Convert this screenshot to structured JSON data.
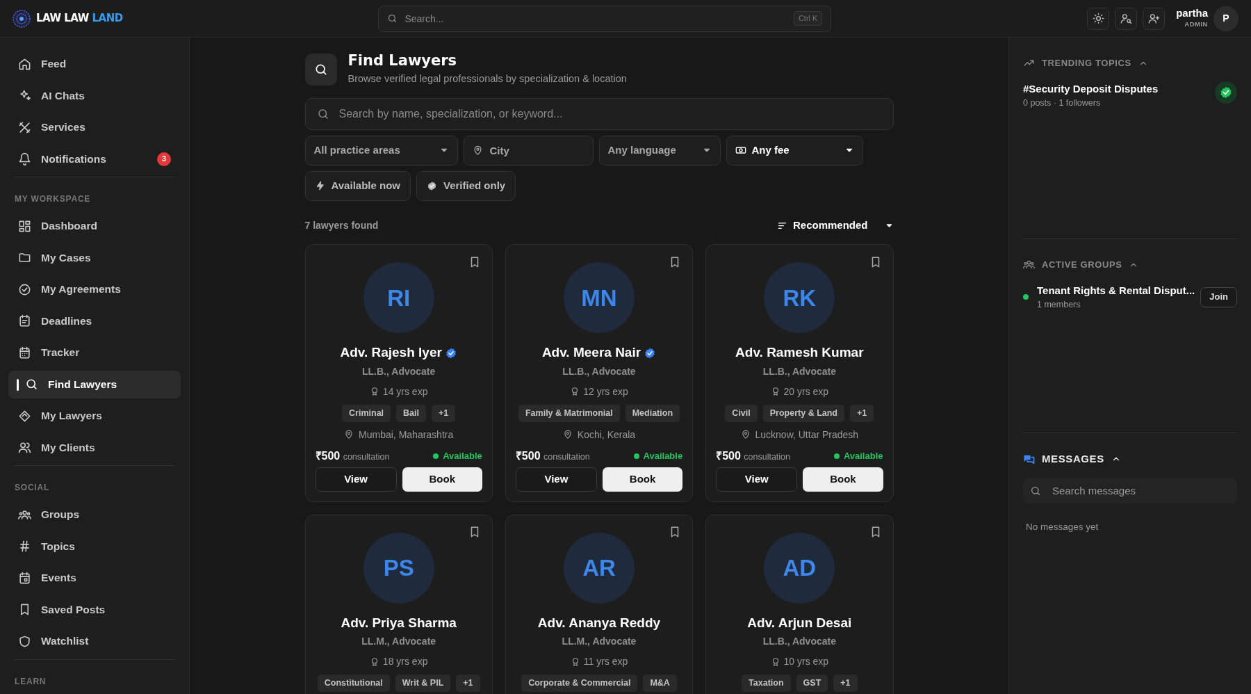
{
  "brand": {
    "text": "LAW LAW",
    "accent": "LAND"
  },
  "header": {
    "search_placeholder": "Search...",
    "shortcut": "Ctrl K",
    "user": {
      "name": "partha",
      "role": "ADMIN",
      "initial": "P"
    }
  },
  "sidebar": {
    "sections": [
      {
        "items": [
          {
            "label": "Feed",
            "selected": false
          },
          {
            "label": "AI Chats",
            "selected": false
          },
          {
            "label": "Services",
            "selected": false
          },
          {
            "label": "Notifications",
            "selected": false,
            "badge": "3"
          }
        ]
      },
      {
        "title": "MY WORKSPACE",
        "items": [
          {
            "label": "Dashboard",
            "selected": false
          },
          {
            "label": "My Cases",
            "selected": false
          },
          {
            "label": "My Agreements",
            "selected": false
          },
          {
            "label": "Deadlines",
            "selected": false
          },
          {
            "label": "Tracker",
            "selected": false
          },
          {
            "label": "Find Lawyers",
            "selected": true
          },
          {
            "label": "My Lawyers",
            "selected": false
          },
          {
            "label": "My Clients",
            "selected": false
          }
        ]
      },
      {
        "title": "SOCIAL",
        "items": [
          {
            "label": "Groups",
            "selected": false
          },
          {
            "label": "Topics",
            "selected": false
          },
          {
            "label": "Events",
            "selected": false
          },
          {
            "label": "Saved Posts",
            "selected": false
          },
          {
            "label": "Watchlist",
            "selected": false
          }
        ]
      },
      {
        "title": "LEARN"
      }
    ]
  },
  "page": {
    "title": "Find Lawyers",
    "subtitle": "Browse verified legal professionals by specialization & location",
    "search_placeholder": "Search by name, specialization, or keyword..."
  },
  "filters": [
    {
      "kind": "select",
      "value": "All practice areas",
      "active": false
    },
    {
      "kind": "city",
      "placeholder": "City"
    },
    {
      "kind": "select",
      "value": "Any language",
      "active": false
    },
    {
      "kind": "fee",
      "value": "Any fee",
      "active": true
    }
  ],
  "toggles": [
    {
      "label": "Available now",
      "selected": false
    },
    {
      "label": "Verified only",
      "selected": false
    }
  ],
  "results": {
    "count": "7 lawyers found",
    "sort": "Recommended"
  },
  "lawyers": [
    {
      "initials": "RI",
      "name": "Adv. Rajesh Iyer",
      "verified": true,
      "degree": "LL.B., Advocate",
      "experience": "14 yrs exp",
      "tags": [
        "Criminal",
        "Bail",
        "+1"
      ],
      "location": "Mumbai, Maharashtra",
      "fee": "₹500",
      "fee_label": "consultation",
      "status": "Available",
      "available": true,
      "actions": [
        "View",
        "Book"
      ]
    },
    {
      "initials": "MN",
      "name": "Adv. Meera Nair",
      "verified": true,
      "degree": "LL.B., Advocate",
      "experience": "12 yrs exp",
      "tags": [
        "Family & Matrimonial",
        "Mediation"
      ],
      "location": "Kochi, Kerala",
      "fee": "₹500",
      "fee_label": "consultation",
      "status": "Available",
      "available": true,
      "actions": [
        "View",
        "Book"
      ]
    },
    {
      "initials": "RK",
      "name": "Adv. Ramesh Kumar",
      "verified": false,
      "degree": "LL.B., Advocate",
      "experience": "20 yrs exp",
      "tags": [
        "Civil",
        "Property & Land",
        "+1"
      ],
      "location": "Lucknow, Uttar Pradesh",
      "fee": "₹500",
      "fee_label": "consultation",
      "status": "Available",
      "available": true,
      "actions": [
        "View",
        "Book"
      ]
    },
    {
      "initials": "PS",
      "name": "Adv. Priya Sharma",
      "verified": false,
      "degree": "LL.M., Advocate",
      "experience": "18 yrs exp",
      "tags": [
        "Constitutional",
        "Writ & PIL",
        "+1"
      ]
    },
    {
      "initials": "AR",
      "name": "Adv. Ananya Reddy",
      "verified": false,
      "degree": "LL.M., Advocate",
      "experience": "11 yrs exp",
      "tags": [
        "Corporate & Commercial",
        "M&A"
      ]
    },
    {
      "initials": "AD",
      "name": "Adv. Arjun Desai",
      "verified": false,
      "degree": "LL.B., Advocate",
      "experience": "10 yrs exp",
      "tags": [
        "Taxation",
        "GST",
        "+1"
      ]
    }
  ],
  "right_panel": {
    "trending": {
      "title": "TRENDING TOPICS",
      "expanded": true,
      "items": [
        {
          "title": "#Security Deposit Disputes",
          "meta": "0 posts · 1 followers",
          "followed": true
        }
      ]
    },
    "groups": {
      "title": "ACTIVE GROUPS",
      "expanded": true,
      "items": [
        {
          "name": "Tenant Rights & Rental Disput...",
          "members": "1 members",
          "online": true,
          "action": "Join"
        }
      ]
    },
    "messages": {
      "title": "MESSAGES",
      "expanded": true,
      "search_placeholder": "Search messages",
      "empty": "No messages yet"
    }
  }
}
